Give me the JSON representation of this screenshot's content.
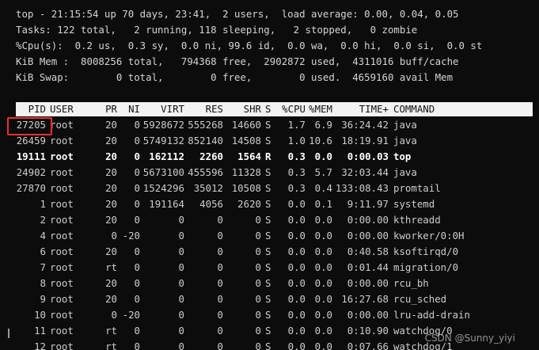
{
  "summary": [
    "top - 21:15:54 up 70 days, 23:41,  2 users,  load average: 0.00, 0.04, 0.05",
    "Tasks: 122 total,   2 running, 118 sleeping,   2 stopped,   0 zombie",
    "%Cpu(s):  0.2 us,  0.3 sy,  0.0 ni, 99.6 id,  0.0 wa,  0.0 hi,  0.0 si,  0.0 st",
    "KiB Mem :  8008256 total,   794368 free,  2902872 used,  4311016 buff/cache",
    "KiB Swap:        0 total,        0 free,        0 used.  4659160 avail Mem"
  ],
  "columns": {
    "pid": "PID",
    "user": "USER",
    "pr": "PR",
    "ni": "NI",
    "virt": "VIRT",
    "res": "RES",
    "shr": "SHR",
    "s": "S",
    "cpu": "%CPU",
    "mem": "%MEM",
    "time": "TIME+",
    "cmd": "COMMAND"
  },
  "processes": [
    {
      "pid": "27205",
      "user": "root",
      "pr": "20",
      "ni": "0",
      "virt": "5928672",
      "res": "555268",
      "shr": "14660",
      "s": "S",
      "cpu": "1.7",
      "mem": "6.9",
      "time": "36:24.42",
      "cmd": "java"
    },
    {
      "pid": "26459",
      "user": "root",
      "pr": "20",
      "ni": "0",
      "virt": "5749132",
      "res": "852140",
      "shr": "14508",
      "s": "S",
      "cpu": "1.0",
      "mem": "10.6",
      "time": "18:19.91",
      "cmd": "java"
    },
    {
      "pid": "19111",
      "user": "root",
      "pr": "20",
      "ni": "0",
      "virt": "162112",
      "res": "2260",
      "shr": "1564",
      "s": "R",
      "cpu": "0.3",
      "mem": "0.0",
      "time": "0:00.03",
      "cmd": "top"
    },
    {
      "pid": "24902",
      "user": "root",
      "pr": "20",
      "ni": "0",
      "virt": "5673100",
      "res": "455596",
      "shr": "11328",
      "s": "S",
      "cpu": "0.3",
      "mem": "5.7",
      "time": "32:03.44",
      "cmd": "java"
    },
    {
      "pid": "27870",
      "user": "root",
      "pr": "20",
      "ni": "0",
      "virt": "1524296",
      "res": "35012",
      "shr": "10508",
      "s": "S",
      "cpu": "0.3",
      "mem": "0.4",
      "time": "133:08.43",
      "cmd": "promtail"
    },
    {
      "pid": "1",
      "user": "root",
      "pr": "20",
      "ni": "0",
      "virt": "191164",
      "res": "4056",
      "shr": "2620",
      "s": "S",
      "cpu": "0.0",
      "mem": "0.1",
      "time": "9:11.97",
      "cmd": "systemd"
    },
    {
      "pid": "2",
      "user": "root",
      "pr": "20",
      "ni": "0",
      "virt": "0",
      "res": "0",
      "shr": "0",
      "s": "S",
      "cpu": "0.0",
      "mem": "0.0",
      "time": "0:00.00",
      "cmd": "kthreadd"
    },
    {
      "pid": "4",
      "user": "root",
      "pr": "0",
      "ni": "-20",
      "virt": "0",
      "res": "0",
      "shr": "0",
      "s": "S",
      "cpu": "0.0",
      "mem": "0.0",
      "time": "0:00.00",
      "cmd": "kworker/0:0H"
    },
    {
      "pid": "6",
      "user": "root",
      "pr": "20",
      "ni": "0",
      "virt": "0",
      "res": "0",
      "shr": "0",
      "s": "S",
      "cpu": "0.0",
      "mem": "0.0",
      "time": "0:40.58",
      "cmd": "ksoftirqd/0"
    },
    {
      "pid": "7",
      "user": "root",
      "pr": "rt",
      "ni": "0",
      "virt": "0",
      "res": "0",
      "shr": "0",
      "s": "S",
      "cpu": "0.0",
      "mem": "0.0",
      "time": "0:01.44",
      "cmd": "migration/0"
    },
    {
      "pid": "8",
      "user": "root",
      "pr": "20",
      "ni": "0",
      "virt": "0",
      "res": "0",
      "shr": "0",
      "s": "S",
      "cpu": "0.0",
      "mem": "0.0",
      "time": "0:00.00",
      "cmd": "rcu_bh"
    },
    {
      "pid": "9",
      "user": "root",
      "pr": "20",
      "ni": "0",
      "virt": "0",
      "res": "0",
      "shr": "0",
      "s": "S",
      "cpu": "0.0",
      "mem": "0.0",
      "time": "16:27.68",
      "cmd": "rcu_sched"
    },
    {
      "pid": "10",
      "user": "root",
      "pr": "0",
      "ni": "-20",
      "virt": "0",
      "res": "0",
      "shr": "0",
      "s": "S",
      "cpu": "0.0",
      "mem": "0.0",
      "time": "0:00.00",
      "cmd": "lru-add-drain"
    },
    {
      "pid": "11",
      "user": "root",
      "pr": "rt",
      "ni": "0",
      "virt": "0",
      "res": "0",
      "shr": "0",
      "s": "S",
      "cpu": "0.0",
      "mem": "0.0",
      "time": "0:10.90",
      "cmd": "watchdog/0"
    },
    {
      "pid": "12",
      "user": "root",
      "pr": "rt",
      "ni": "0",
      "virt": "0",
      "res": "0",
      "shr": "0",
      "s": "S",
      "cpu": "0.0",
      "mem": "0.0",
      "time": "0:07.66",
      "cmd": "watchdog/1"
    }
  ],
  "watermark": "CSDN @Sunny_yiyi",
  "colors": {
    "background": "#0c0c0c",
    "text": "#cccccc",
    "header_bg": "#f2f2f2",
    "highlight": "#e8322e"
  }
}
